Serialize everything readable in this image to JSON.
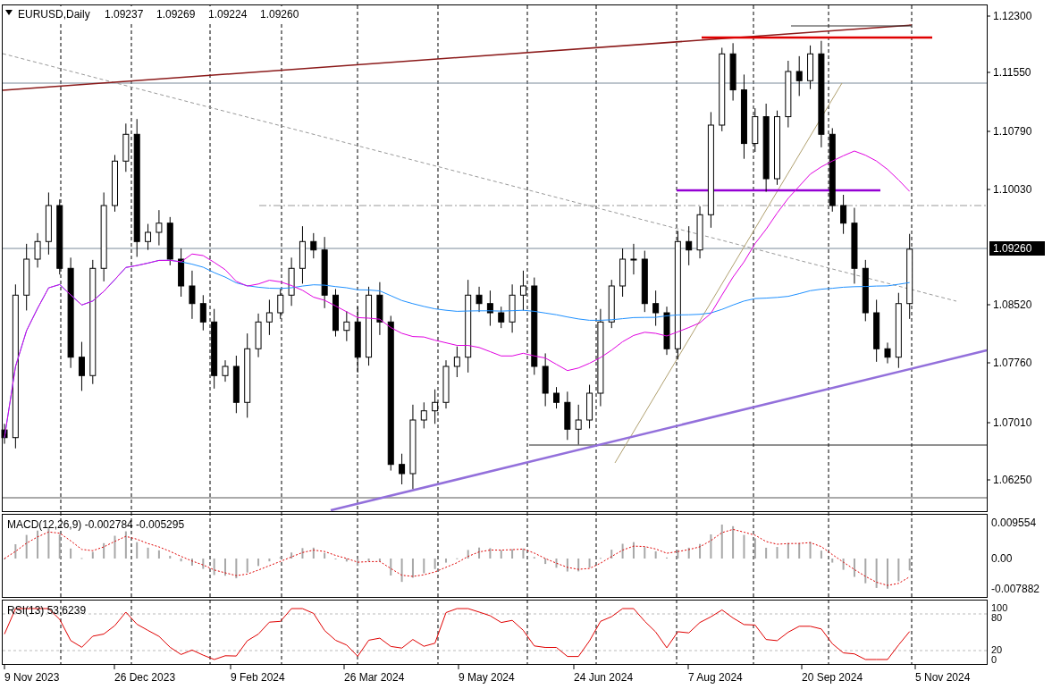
{
  "header": {
    "symbol": "EURUSD,Daily",
    "open": "1.09237",
    "high": "1.09269",
    "low": "1.09224",
    "close": "1.09260"
  },
  "price_chart": {
    "current_price": "1.09260",
    "price_axis": [
      "1.12300",
      "1.11550",
      "1.10790",
      "1.10030",
      "1.08520",
      "1.07760",
      "1.07010",
      "1.06250"
    ],
    "time_axis": [
      "9 Nov 2023",
      "26 Dec 2023",
      "9 Feb 2024",
      "26 Mar 2024",
      "9 May 2024",
      "24 Jun 2024",
      "7 Aug 2024",
      "20 Sep 2024",
      "5 Nov 2024"
    ]
  },
  "macd": {
    "label": "MACD(12,26,9) -0.002784 -0.005295",
    "scale": [
      "0.009554",
      "0.00",
      "-0.007882"
    ]
  },
  "rsi": {
    "label": "RSI(13) 53.6239",
    "scale": [
      "100",
      "80",
      "20",
      "0"
    ]
  }
}
